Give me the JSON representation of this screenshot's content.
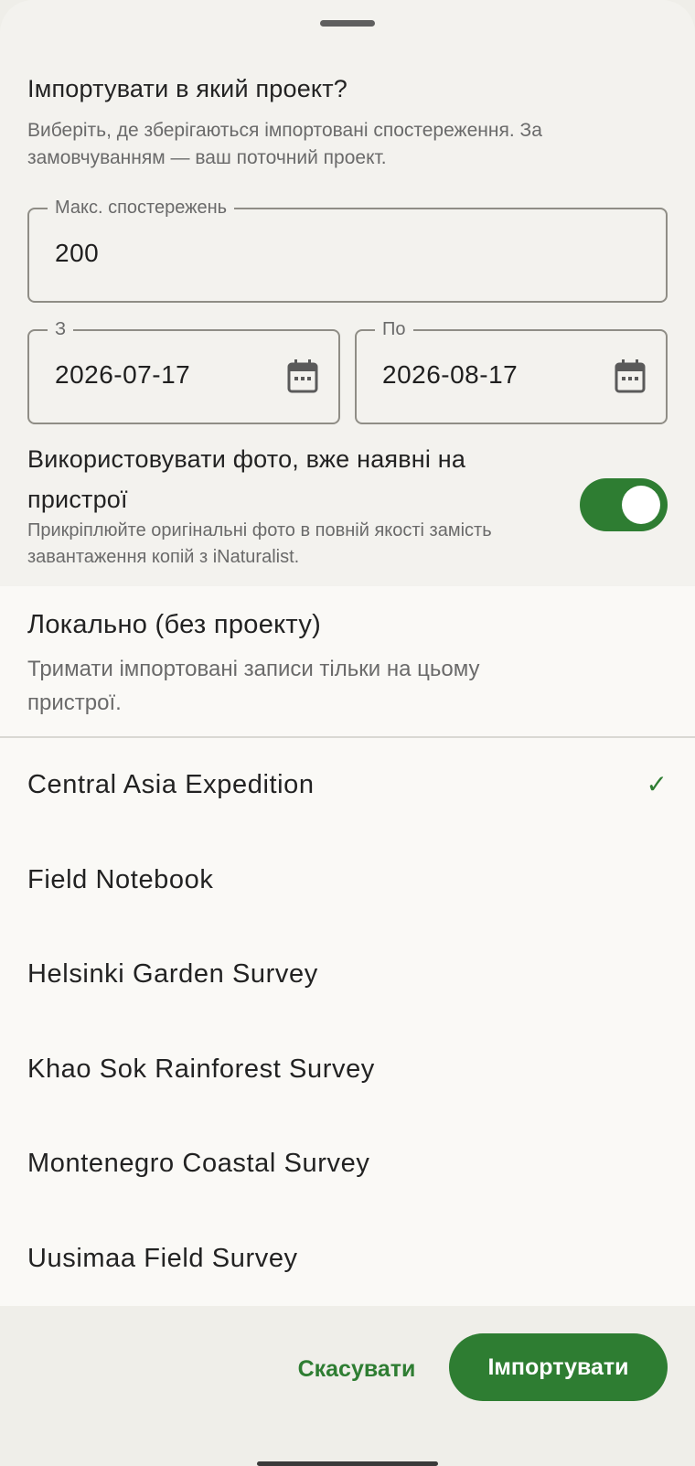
{
  "dialog": {
    "title": "Імпортувати в який проект?",
    "subtitle": "Виберіть, де зберігаються імпортовані спостереження. За замовчуванням — ваш поточний проект."
  },
  "fields": {
    "max_observations": {
      "label": "Макс. спостережень",
      "value": "200"
    },
    "date_from": {
      "label": "З",
      "value": "2026-07-17",
      "icon": "calendar-icon"
    },
    "date_to": {
      "label": "По",
      "value": "2026-08-17",
      "icon": "calendar-icon"
    }
  },
  "use_device_photos": {
    "title": "Використовувати фото, вже наявні на пристрої",
    "description": "Прикріплюйте оригінальні фото в повній якості замість завантаження копій з iNaturalist.",
    "enabled": true
  },
  "local_option": {
    "title": "Локально (без проекту)",
    "description": "Тримати імпортовані записи тільки на цьому пристрої."
  },
  "projects": [
    {
      "name": "Central Asia Expedition",
      "selected": true,
      "check": "✓"
    },
    {
      "name": "Field Notebook",
      "selected": false
    },
    {
      "name": "Helsinki Garden Survey",
      "selected": false
    },
    {
      "name": "Khao Sok Rainforest Survey",
      "selected": false
    },
    {
      "name": "Montenegro Coastal Survey",
      "selected": false
    },
    {
      "name": "Uusimaa Field Survey",
      "selected": false
    }
  ],
  "actions": {
    "cancel_label": "Скасувати",
    "import_label": "Імпортувати"
  },
  "colors": {
    "accent": "#2e7d32",
    "background": "#f3f2ee"
  }
}
